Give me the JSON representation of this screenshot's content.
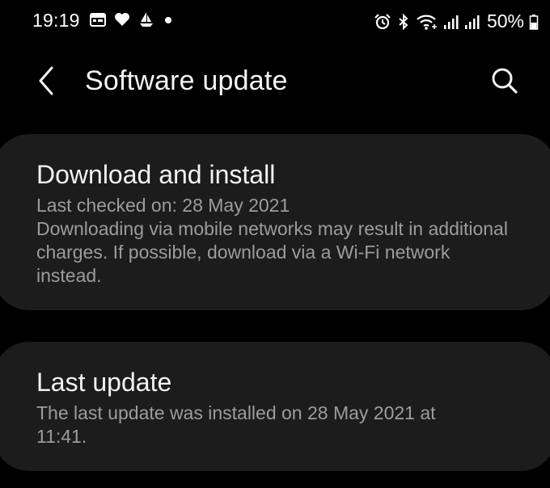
{
  "status_bar": {
    "time": "19:19",
    "left_icons": [
      "calendar-icon",
      "heart-icon",
      "sailing-icon",
      "dot-icon"
    ],
    "right_icons": [
      "alarm-icon",
      "bluetooth-icon",
      "wifi-icon",
      "signal-icon",
      "signal-icon"
    ],
    "battery_percent": "50%"
  },
  "header": {
    "title": "Software update",
    "back_icon": "chevron-left-icon",
    "search_icon": "search-icon"
  },
  "cards": {
    "download": {
      "title": "Download and install",
      "last_checked": "Last checked on: 28 May 2021",
      "description": "Downloading via mobile networks may result in additional charges. If possible, download via a Wi-Fi network instead."
    },
    "last_update": {
      "title": "Last update",
      "description": "The last update was installed on 28 May 2021 at 11:41."
    }
  },
  "colors": {
    "background": "#000000",
    "card": "#1c1c1c",
    "primary_text": "#f2f2f2",
    "secondary_text": "#9c9c9c"
  }
}
